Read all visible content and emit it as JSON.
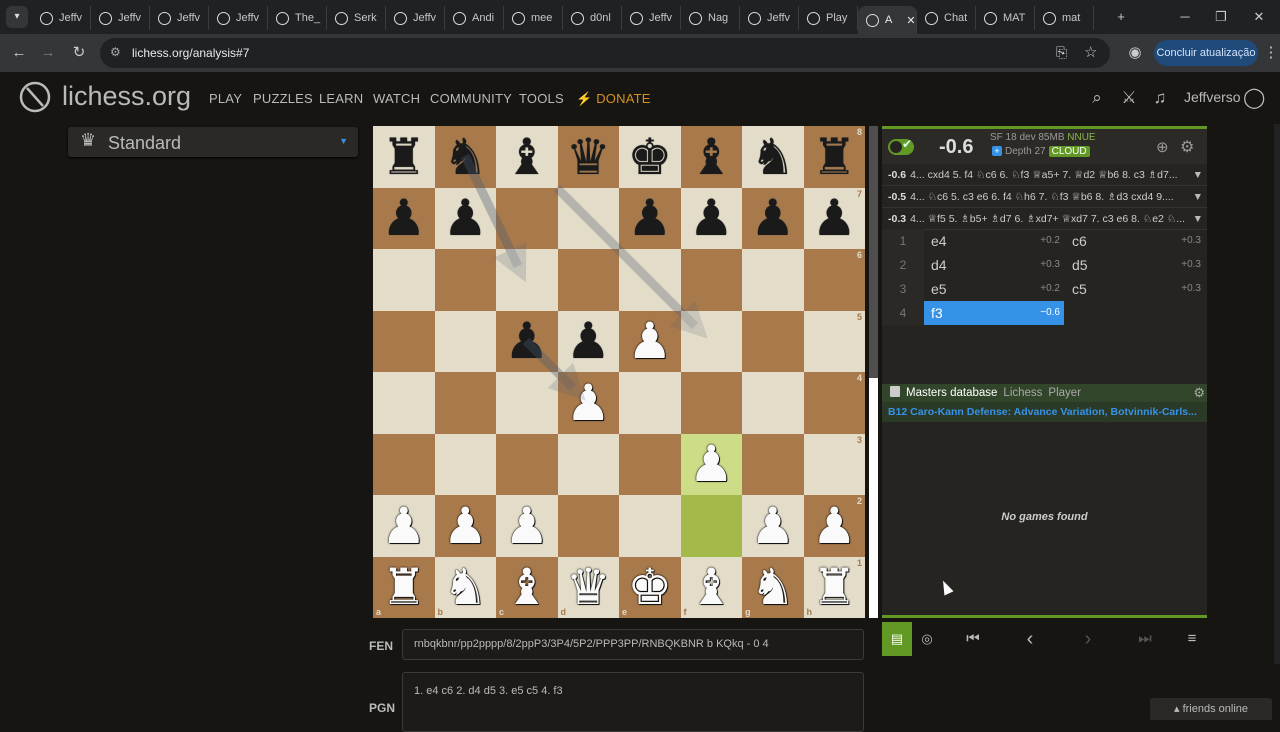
{
  "browser": {
    "tabs": [
      {
        "label": "Jeffv"
      },
      {
        "label": "Jeffv"
      },
      {
        "label": "Jeffv"
      },
      {
        "label": "Jeffv"
      },
      {
        "label": "The_"
      },
      {
        "label": "Serk"
      },
      {
        "label": "Jeffv"
      },
      {
        "label": "Andi"
      },
      {
        "label": "mee"
      },
      {
        "label": "d0nl"
      },
      {
        "label": "Jeffv"
      },
      {
        "label": "Nag"
      },
      {
        "label": "Jeffv"
      },
      {
        "label": "Play"
      },
      {
        "label": "A"
      },
      {
        "label": "Chat"
      },
      {
        "label": "MAT"
      },
      {
        "label": "mat"
      }
    ],
    "url": "lichess.org/analysis#7",
    "update_button": "Concluir atualização"
  },
  "header": {
    "logo": "lichess.org",
    "nav": [
      "PLAY",
      "PUZZLES",
      "LEARN",
      "WATCH",
      "COMMUNITY",
      "TOOLS"
    ],
    "donate": "DONATE",
    "username": "Jeffverso"
  },
  "variant": "Standard",
  "board": {
    "ranks": [
      [
        "r",
        "n",
        "b",
        "q",
        "k",
        "b",
        "n",
        "r"
      ],
      [
        "p",
        "p",
        "",
        "",
        "p",
        "p",
        "p",
        "p"
      ],
      [
        "",
        "",
        "",
        "",
        "",
        "",
        "",
        ""
      ],
      [
        "",
        "",
        "p",
        "p",
        "P",
        "",
        "",
        ""
      ],
      [
        "",
        "",
        "",
        "P",
        "",
        "",
        "",
        ""
      ],
      [
        "",
        "",
        "",
        "",
        "",
        "P",
        "",
        ""
      ],
      [
        "P",
        "P",
        "P",
        "",
        "",
        "",
        "P",
        "P"
      ],
      [
        "R",
        "N",
        "B",
        "Q",
        "K",
        "B",
        "N",
        "R"
      ]
    ],
    "rank_labels": [
      "8",
      "7",
      "6",
      "5",
      "4",
      "3",
      "2",
      "1"
    ],
    "file_labels": [
      "a",
      "b",
      "c",
      "d",
      "e",
      "f",
      "g",
      "h"
    ],
    "last_move": [
      "f2",
      "f3"
    ]
  },
  "engine": {
    "score": "-0.6",
    "info": "SF 18 dev 85MB",
    "nnue": "NNUE",
    "depth": "Depth 27",
    "cloud": "CLOUD",
    "pvs": [
      {
        "eval": "-0.6",
        "line": "4... cxd4 5. f4 ♘c6 6. ♘f3 ♕a5+ 7. ♕d2 ♕b6 8. c3 ♗d7..."
      },
      {
        "eval": "-0.5",
        "line": "4... ♘c6 5. c3 e6 6. f4 ♘h6 7. ♘f3 ♕b6 8. ♗d3 cxd4 9...."
      },
      {
        "eval": "-0.3",
        "line": "4... ♕f5 5. ♗b5+ ♗d7 6. ♗xd7+ ♕xd7 7. c3 e6 8. ♘e2 ♘..."
      }
    ]
  },
  "moves": [
    {
      "num": "1",
      "white": "e4",
      "white_eval": "+0.2",
      "black": "c6",
      "black_eval": "+0.3"
    },
    {
      "num": "2",
      "white": "d4",
      "white_eval": "+0.3",
      "black": "d5",
      "black_eval": "+0.3"
    },
    {
      "num": "3",
      "white": "e5",
      "white_eval": "+0.2",
      "black": "c5",
      "black_eval": "+0.3"
    },
    {
      "num": "4",
      "white": "f3",
      "white_eval": "−0.6",
      "black": "",
      "black_eval": ""
    }
  ],
  "explorer": {
    "tabs": [
      "Masters database",
      "Lichess",
      "Player"
    ],
    "opening": "B12 Caro-Kann Defense: Advance Variation, Botvinnik-Carls...",
    "empty": "No games found"
  },
  "fen": {
    "label": "FEN",
    "value": "rnbqkbnr/pp2pppp/8/2ppP3/3P4/5P2/PPP3PP/RNBQKBNR b KQkq - 0 4"
  },
  "pgn": {
    "label": "PGN",
    "value": "1. e4 c6 2. d4 d5 3. e5 c5 4. f3"
  },
  "friends": "friends online",
  "icons": {
    "piece_glyphs": {
      "k": "♚",
      "q": "♛",
      "r": "♜",
      "b": "♝",
      "n": "♞",
      "p": "♟"
    }
  },
  "colors": {
    "accent": "#3692e7",
    "green": "#629924",
    "donate": "#d59120"
  }
}
